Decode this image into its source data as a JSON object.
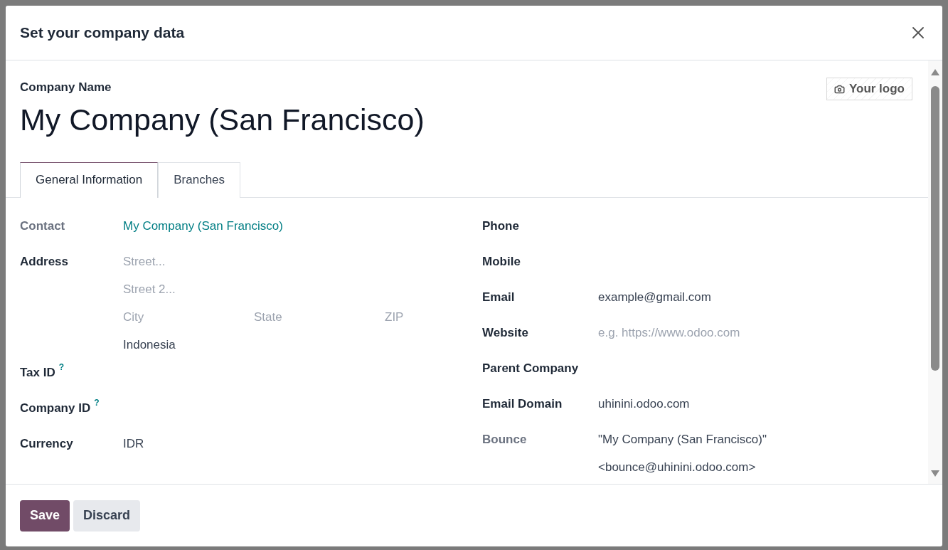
{
  "dialog": {
    "title": "Set your company data"
  },
  "company_name_label": "Company Name",
  "company_name": "My Company (San Francisco)",
  "logo_button": "Your logo",
  "tabs": [
    {
      "label": "General Information",
      "selected": true
    },
    {
      "label": "Branches",
      "selected": false
    }
  ],
  "left_fields": [
    {
      "label": "Contact",
      "muted": true,
      "lines": [
        [
          {
            "kind": "link",
            "text": "My Company (San Francisco)"
          }
        ]
      ]
    },
    {
      "label": "Address",
      "muted": false,
      "lines": [
        [
          {
            "kind": "placeholder",
            "text": "Street..."
          }
        ],
        [
          {
            "kind": "placeholder",
            "text": "Street 2..."
          }
        ],
        [
          {
            "kind": "placeholder",
            "text": "City"
          },
          {
            "kind": "placeholder",
            "text": "State"
          },
          {
            "kind": "placeholder",
            "text": "ZIP"
          }
        ],
        [
          {
            "kind": "text",
            "text": "Indonesia"
          }
        ]
      ]
    },
    {
      "label": "Tax ID",
      "muted": false,
      "help": "?"
    },
    {
      "label": "Company ID",
      "muted": false,
      "help": "?"
    },
    {
      "label": "Currency",
      "muted": false,
      "lines": [
        [
          {
            "kind": "text",
            "text": "IDR"
          }
        ]
      ]
    }
  ],
  "right_fields": [
    {
      "label": "Phone",
      "muted": false
    },
    {
      "label": "Mobile",
      "muted": false
    },
    {
      "label": "Email",
      "muted": false,
      "lines": [
        [
          {
            "kind": "text",
            "text": "example@gmail.com"
          }
        ]
      ]
    },
    {
      "label": "Website",
      "muted": false,
      "lines": [
        [
          {
            "kind": "placeholder",
            "text": "e.g. https://www.odoo.com"
          }
        ]
      ]
    },
    {
      "label": "Parent Company",
      "muted": false
    },
    {
      "label": "Email Domain",
      "muted": false,
      "lines": [
        [
          {
            "kind": "text",
            "text": "uhinini.odoo.com"
          }
        ]
      ]
    },
    {
      "label": "Bounce",
      "muted": true,
      "lines": [
        [
          {
            "kind": "text",
            "text": "\"My Company (San Francisco)\""
          }
        ],
        [
          {
            "kind": "text",
            "text": "<bounce@uhinini.odoo.com>"
          }
        ]
      ]
    }
  ],
  "footer_buttons": [
    {
      "label": "Save",
      "kind": "primary"
    },
    {
      "label": "Discard",
      "kind": "secondary"
    }
  ]
}
